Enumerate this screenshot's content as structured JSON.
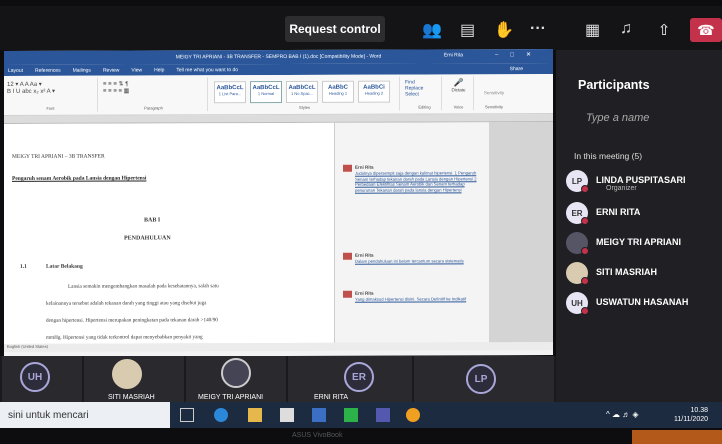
{
  "teams": {
    "request_control": "Request control",
    "participants_title": "Participants",
    "search_placeholder": "Type a name",
    "in_meeting": "In this meeting (5)"
  },
  "participants": [
    {
      "initials": "LP",
      "name": "LINDA PUSPITASARI",
      "role": "Organizer"
    },
    {
      "initials": "ER",
      "name": "ERNI RITA",
      "role": ""
    },
    {
      "initials": "",
      "name": "MEIGY TRI APRIANI",
      "role": ""
    },
    {
      "initials": "",
      "name": "SITI MASRIAH",
      "role": ""
    },
    {
      "initials": "UH",
      "name": "USWATUN HASANAH",
      "role": ""
    }
  ],
  "video_strip": {
    "uh": "UH",
    "siti": "SITI MASRIAH",
    "meigy": "MEIGY TRI APRIANI",
    "erni": "ERNI RITA",
    "er": "ER",
    "lp": "LP"
  },
  "word": {
    "title": "MEIGY TRI APRIANI - 3B TRANSFER - SEMPRO BAB I (1).doc [Compatibility Mode] - Word",
    "user": "Erni Rita",
    "menu": [
      "Layout",
      "References",
      "Mailings",
      "Review",
      "View",
      "Help",
      "Tell me what you want to do"
    ],
    "share": "Share",
    "ribbon_font": "Font",
    "ribbon_paragraph": "Paragraph",
    "ribbon_styles": "Styles",
    "ribbon_editing": "Editing",
    "ribbon_voice": "Voice",
    "ribbon_sensitivity": "Sensitivity",
    "styles": [
      {
        "sample": "AaBbCcL",
        "name": "1 List Para..."
      },
      {
        "sample": "AaBbCcL",
        "name": "1 Normal"
      },
      {
        "sample": "AaBbCcL",
        "name": "1 No Spac..."
      },
      {
        "sample": "AaBbC",
        "name": "Heading 1"
      },
      {
        "sample": "AaBbCi",
        "name": "Heading 2"
      }
    ],
    "find": "Find",
    "replace": "Replace",
    "select": "Select",
    "dictate": "Dictate",
    "doc_header": "MEIGY TRI APRIANI – 3B TRANSFER",
    "doc_topic": "Pengaruh senam Aerobik pada Lansia dengan Hipertensi",
    "bab": "BAB I",
    "chapter": "PENDAHULUAN",
    "section_no": "1.1",
    "section": "Latar Belakang",
    "para": [
      "Lansia semakin mengembangkan masalah pada kesehatannya, salah satu",
      "kelainannya tersebut adalah tekanan darah yang tinggi atau yang disebut juga",
      "dengan hipertensi. Hipertensi merupakan peningkatan pada tekanan darah >140/90",
      "mmHg. Hipertensi yang tidak terkontrol dapat menyebabkan penyakit yang"
    ],
    "status": "English (United States)",
    "comments": [
      {
        "name": "Erni Rita",
        "text": "Judulnya dipersempit saja dengan kalimat hipertensi. 1 Pengaruh Senam terhadap tekanan darah pada Lansia dengan Hipertensi 2 Perbedaan Efektifitas Senam Aerobik dan Senam terhadap penurunan Tekanan darah pada lansia dengan Hipertensi"
      },
      {
        "name": "Erni Rita",
        "text": "Dalam pendahuluan ini belum tercantum secara sistematis"
      },
      {
        "name": "Erni Rita",
        "text": "Yang dimaksud Hipertensi disini. Secara Definitif ke Indikatif"
      }
    ]
  },
  "taskbar": {
    "search": "sini untuk mencari",
    "time": "10.38",
    "date": "11/11/2020"
  },
  "laptop_brand": "ASUS VivoBook"
}
